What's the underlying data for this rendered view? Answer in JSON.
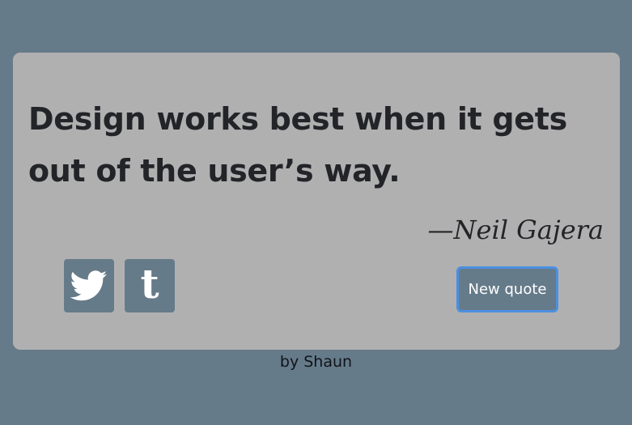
{
  "quote_box": {
    "text": "Design works best when it gets out of the user’s way.",
    "author": "—Neil Gajera"
  },
  "share": {
    "twitter_icon": "twitter-bird-icon",
    "tumblr_icon": "tumblr-icon",
    "tumblr_glyph": "t"
  },
  "new_quote_label": "New quote",
  "footer": {
    "credit": "by Shaun"
  },
  "colors": {
    "page_background": "#667b8a",
    "card_background": "#b1b0b1",
    "button_background": "#667b8a",
    "focus_ring": "#4b90e1",
    "text_dark": "#222428"
  }
}
